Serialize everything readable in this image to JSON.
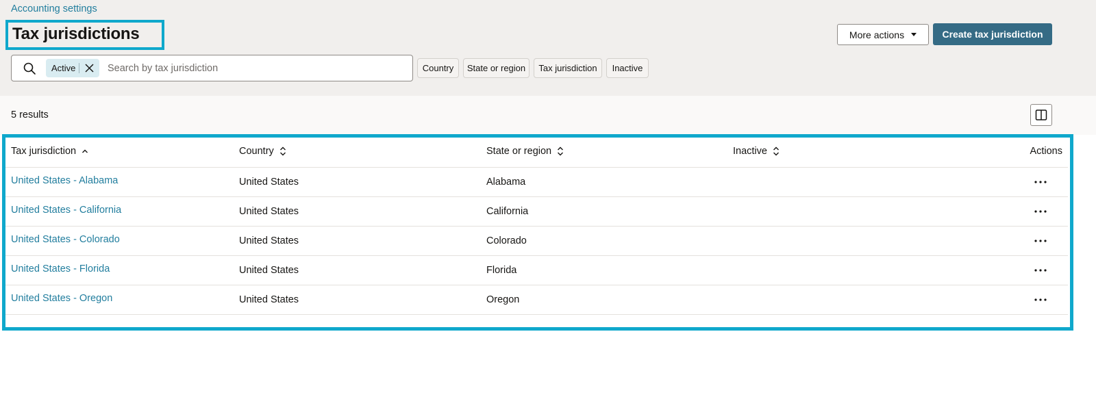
{
  "header": {
    "breadcrumb": "Accounting settings",
    "title": "Tax jurisdictions",
    "more_actions_label": "More actions",
    "create_label": "Create tax jurisdiction"
  },
  "search": {
    "chip_label": "Active",
    "placeholder": "Search by tax jurisdiction",
    "value": ""
  },
  "filters": [
    "Country",
    "State or region",
    "Tax jurisdiction",
    "Inactive"
  ],
  "results": {
    "count_label": "5 results"
  },
  "table": {
    "columns": [
      "Tax jurisdiction",
      "Country",
      "State or region",
      "Inactive",
      "Actions"
    ],
    "rows": [
      {
        "jurisdiction": "United States - Alabama",
        "country": "United States",
        "state": "Alabama",
        "inactive": ""
      },
      {
        "jurisdiction": "United States - California",
        "country": "United States",
        "state": "California",
        "inactive": ""
      },
      {
        "jurisdiction": "United States - Colorado",
        "country": "United States",
        "state": "Colorado",
        "inactive": ""
      },
      {
        "jurisdiction": "United States - Florida",
        "country": "United States",
        "state": "Florida",
        "inactive": ""
      },
      {
        "jurisdiction": "United States - Oregon",
        "country": "United States",
        "state": "Oregon",
        "inactive": ""
      }
    ]
  },
  "icons": {
    "search": "search-icon",
    "chip_close": "close-icon",
    "more_caret": "caret-down-icon",
    "columns": "columns-icon",
    "sort_asc": "sort-ascending-icon",
    "sort_both": "sort-icon",
    "row_actions": "more-horizontal-icon"
  },
  "colors": {
    "link": "#227e9e",
    "primary_button": "#356b85",
    "highlight_border": "#0fa8cc",
    "header_background": "#f1efed"
  }
}
